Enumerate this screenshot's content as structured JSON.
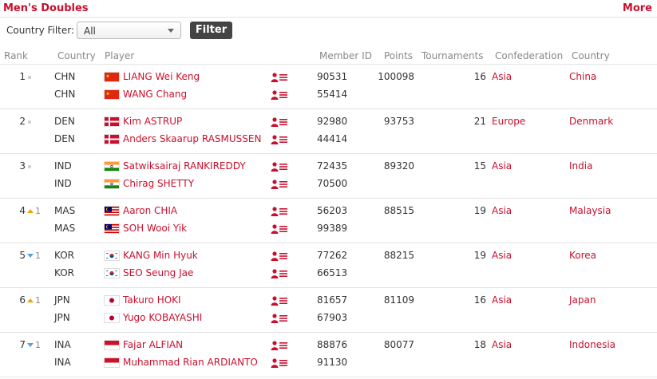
{
  "header": {
    "title": "Men's Doubles",
    "more_label": "More"
  },
  "filter": {
    "label": "Country Filter:",
    "selected": "All",
    "button_label": "Filter"
  },
  "columns": {
    "rank": "Rank",
    "country": "Country",
    "player": "Player",
    "member_id": "Member ID",
    "points": "Points",
    "tournaments": "Tournaments",
    "confederation": "Confederation",
    "country_name": "Country"
  },
  "rows": [
    {
      "rank": "1",
      "movement_type": "same",
      "movement": "",
      "players": [
        {
          "country": "CHN",
          "flag": "chn",
          "name": "LIANG Wei Keng",
          "member_id": "90531"
        },
        {
          "country": "CHN",
          "flag": "chn",
          "name": "WANG Chang",
          "member_id": "55414"
        }
      ],
      "points": "100098",
      "tournaments": "16",
      "confederation": "Asia",
      "country_name": "China"
    },
    {
      "rank": "2",
      "movement_type": "same",
      "movement": "",
      "players": [
        {
          "country": "DEN",
          "flag": "den",
          "name": "Kim ASTRUP",
          "member_id": "92980"
        },
        {
          "country": "DEN",
          "flag": "den",
          "name": "Anders Skaarup RASMUSSEN",
          "member_id": "44414"
        }
      ],
      "points": "93753",
      "tournaments": "21",
      "confederation": "Europe",
      "country_name": "Denmark"
    },
    {
      "rank": "3",
      "movement_type": "same",
      "movement": "",
      "players": [
        {
          "country": "IND",
          "flag": "ind",
          "name": "Satwiksairaj RANKIREDDY",
          "member_id": "72435"
        },
        {
          "country": "IND",
          "flag": "ind",
          "name": "Chirag SHETTY",
          "member_id": "70500"
        }
      ],
      "points": "89320",
      "tournaments": "15",
      "confederation": "Asia",
      "country_name": "India"
    },
    {
      "rank": "4",
      "movement_type": "up",
      "movement": "1",
      "players": [
        {
          "country": "MAS",
          "flag": "mas",
          "name": "Aaron CHIA",
          "member_id": "56203"
        },
        {
          "country": "MAS",
          "flag": "mas",
          "name": "SOH Wooi Yik",
          "member_id": "99389"
        }
      ],
      "points": "88515",
      "tournaments": "19",
      "confederation": "Asia",
      "country_name": "Malaysia"
    },
    {
      "rank": "5",
      "movement_type": "down",
      "movement": "1",
      "players": [
        {
          "country": "KOR",
          "flag": "kor",
          "name": "KANG Min Hyuk",
          "member_id": "77262"
        },
        {
          "country": "KOR",
          "flag": "kor",
          "name": "SEO Seung Jae",
          "member_id": "66513"
        }
      ],
      "points": "88215",
      "tournaments": "19",
      "confederation": "Asia",
      "country_name": "Korea"
    },
    {
      "rank": "6",
      "movement_type": "up",
      "movement": "1",
      "players": [
        {
          "country": "JPN",
          "flag": "jpn",
          "name": "Takuro HOKI",
          "member_id": "81657"
        },
        {
          "country": "JPN",
          "flag": "jpn",
          "name": "Yugo KOBAYASHI",
          "member_id": "67903"
        }
      ],
      "points": "81109",
      "tournaments": "16",
      "confederation": "Asia",
      "country_name": "Japan"
    },
    {
      "rank": "7",
      "movement_type": "down",
      "movement": "1",
      "players": [
        {
          "country": "INA",
          "flag": "ina",
          "name": "Fajar ALFIAN",
          "member_id": "88876"
        },
        {
          "country": "INA",
          "flag": "ina",
          "name": "Muhammad Rian ARDIANTO",
          "member_id": "91130"
        }
      ],
      "points": "80077",
      "tournaments": "18",
      "confederation": "Asia",
      "country_name": "Indonesia"
    }
  ],
  "colors": {
    "accent_red": "#c8102e",
    "up_arrow": "#f0a500",
    "down_arrow": "#5aa0d8",
    "button_dark": "#444444"
  },
  "icons": {
    "profile": "player-profile-icon",
    "dropdown": "chevron-down-icon"
  }
}
